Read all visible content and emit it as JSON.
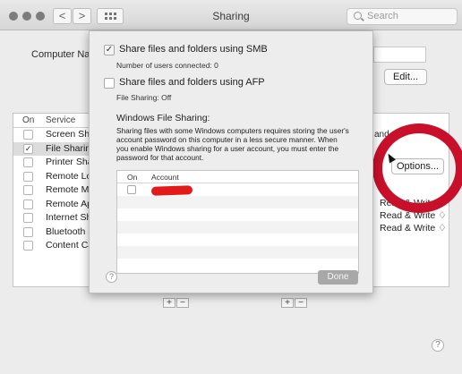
{
  "window": {
    "title": "Sharing"
  },
  "toolbar": {
    "back": "<",
    "forward": ">",
    "search_placeholder": "Search"
  },
  "background": {
    "computer_name_label": "Computer Na",
    "edit_button": "Edit...",
    "service_headers": {
      "on": "On",
      "service": "Service"
    },
    "services": [
      {
        "label": "Screen Sha",
        "checked": false
      },
      {
        "label": "File Sharing",
        "checked": true
      },
      {
        "label": "Printer Sha",
        "checked": false
      },
      {
        "label": "Remote Log",
        "checked": false
      },
      {
        "label": "Remote Ma",
        "checked": false
      },
      {
        "label": "Remote Ap",
        "checked": false
      },
      {
        "label": "Internet Sh",
        "checked": false
      },
      {
        "label": "Bluetooth S",
        "checked": false
      },
      {
        "label": "Content Ca",
        "checked": false
      }
    ],
    "right_fragment": "and",
    "options_button": "Options...",
    "permissions": [
      "Read & Write ♢",
      "Read & Write ♢",
      "Read & Write ♢"
    ],
    "plus": "+",
    "minus": "−",
    "help": "?"
  },
  "sheet": {
    "smb_label": "Share files and folders using SMB",
    "smb_checked": true,
    "smb_status": "Number of users connected: 0",
    "afp_label": "Share files and folders using AFP",
    "afp_checked": false,
    "afp_status": "File Sharing: Off",
    "windows_heading": "Windows File Sharing:",
    "windows_description": "Sharing files with some Windows computers requires storing the user's account password on this computer in a less secure manner.  When you enable Windows sharing for a user account, you must enter the password for that account.",
    "accounts_headers": {
      "on": "On",
      "account": "Account"
    },
    "accounts": [
      {
        "checked": false
      }
    ],
    "help": "?",
    "done_button": "Done"
  },
  "annotation": {
    "ring_color": "#c9102b",
    "redaction_color": "#e31a1a"
  }
}
